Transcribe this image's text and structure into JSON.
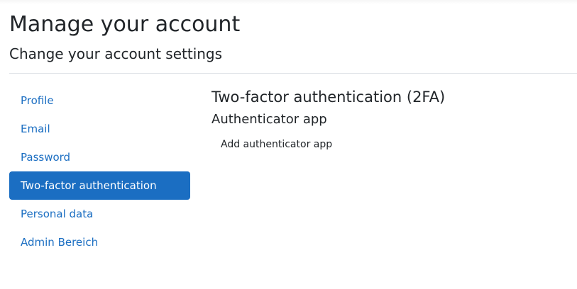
{
  "header": {
    "title": "Manage your account",
    "subtitle": "Change your account settings"
  },
  "sidebar": {
    "items": [
      {
        "label": "Profile",
        "active": false
      },
      {
        "label": "Email",
        "active": false
      },
      {
        "label": "Password",
        "active": false
      },
      {
        "label": "Two-factor authentication",
        "active": true
      },
      {
        "label": "Personal data",
        "active": false
      },
      {
        "label": "Admin Bereich",
        "active": false
      }
    ]
  },
  "main": {
    "title": "Two-factor authentication (2FA)",
    "subtitle": "Authenticator app",
    "add_app_label": "Add authenticator app"
  },
  "colors": {
    "accent": "#1b6ec2",
    "text": "#212529",
    "divider": "#dee2e6"
  }
}
